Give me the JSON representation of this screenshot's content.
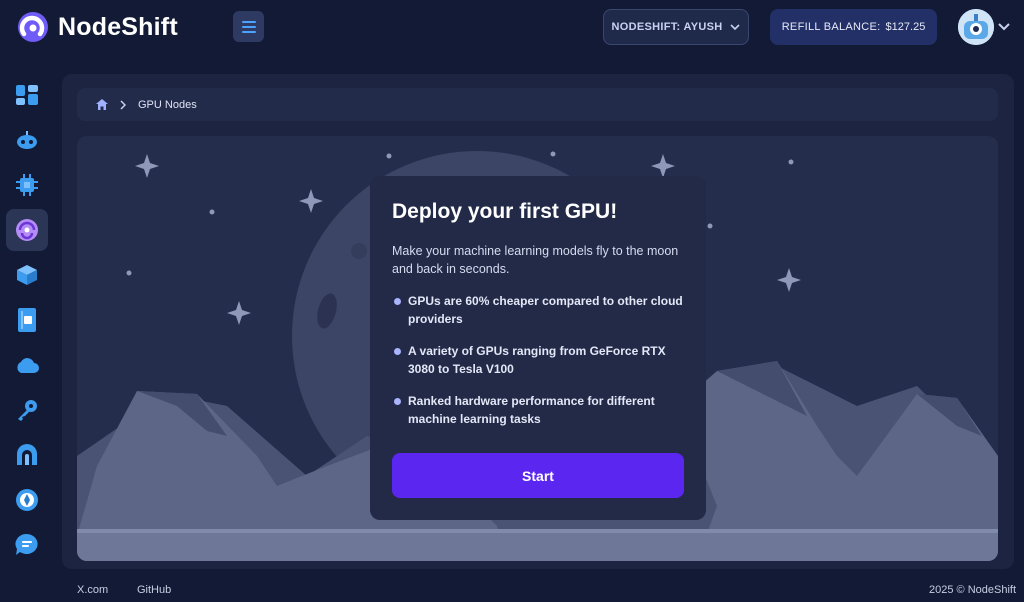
{
  "brand": {
    "name": "NodeShift"
  },
  "header": {
    "org_label": "NODESHIFT: AYUSH",
    "refill_label": "REFILL BALANCE:",
    "refill_amount": "$127.25"
  },
  "sidebar": {
    "items": [
      {
        "icon": "dashboard-icon"
      },
      {
        "icon": "robot-icon"
      },
      {
        "icon": "cpu-chip-icon"
      },
      {
        "icon": "gpu-nodes-icon",
        "active": true
      },
      {
        "icon": "cube-icon"
      },
      {
        "icon": "storage-icon"
      },
      {
        "icon": "cloud-icon"
      },
      {
        "icon": "key-icon"
      },
      {
        "icon": "network-icon"
      },
      {
        "icon": "compass-icon"
      },
      {
        "icon": "chat-icon"
      }
    ]
  },
  "breadcrumb": {
    "current": "GPU Nodes"
  },
  "card": {
    "title": "Deploy your first GPU!",
    "description": "Make your machine learning models fly to the moon and back in seconds.",
    "bullets": [
      "GPUs are 60% cheaper compared to other cloud providers",
      "A variety of GPUs ranging from GeForce RTX 3080 to Tesla V100",
      "Ranked hardware performance for different machine learning tasks"
    ],
    "start_label": "Start"
  },
  "footer": {
    "link1": "X.com",
    "link2": "GitHub",
    "copyright": "2025 © NodeShift"
  },
  "colors": {
    "background": "#131a35",
    "accent": "#5b27f0",
    "icon_blue": "#3b9cf0"
  }
}
